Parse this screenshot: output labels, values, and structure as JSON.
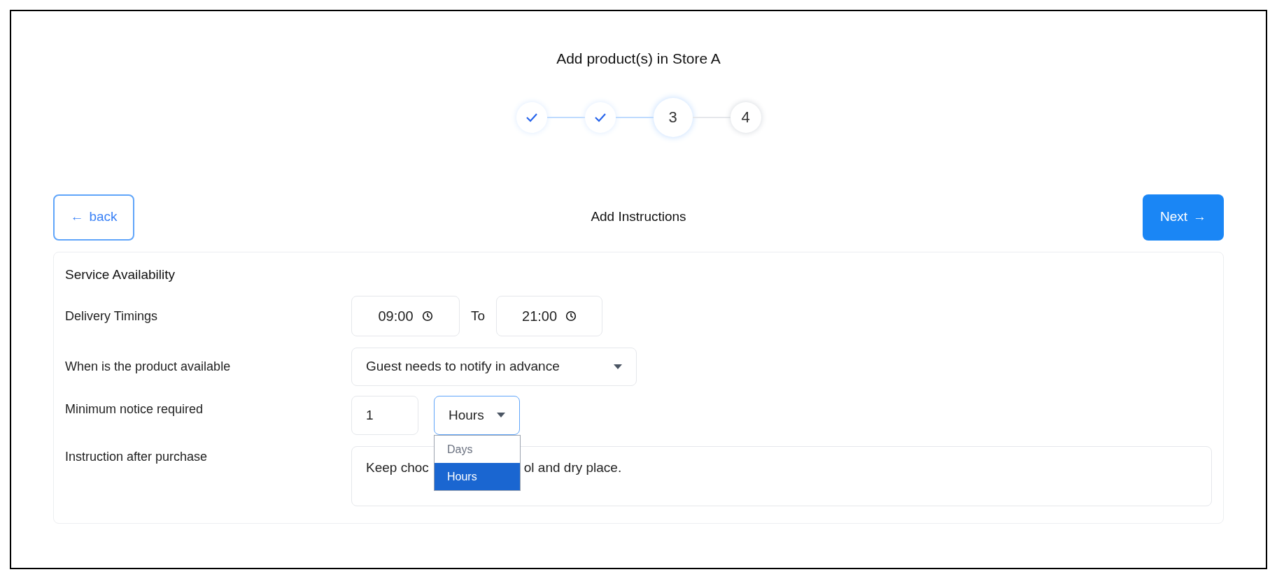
{
  "title": "Add product(s) in Store A",
  "steps": [
    {
      "done": true,
      "selected": false
    },
    {
      "done": true,
      "selected": false
    },
    {
      "done": false,
      "selected": true,
      "label": "3"
    },
    {
      "done": false,
      "selected": false,
      "label": "4"
    }
  ],
  "back_button": {
    "arrow": "←",
    "label": "back"
  },
  "section_title": "Add Instructions",
  "next_button": {
    "label": "Next",
    "arrow": "→"
  },
  "card": {
    "heading": "Service Availability",
    "delivery": {
      "label": "Delivery Timings",
      "from": "09:00",
      "separator": "To",
      "to": "21:00"
    },
    "availability": {
      "label": "When is the product available",
      "value": "Guest needs to notify in advance"
    },
    "notice": {
      "label": "Minimum notice required",
      "amount": "1",
      "unit": "Hours",
      "expanded": true,
      "options": [
        {
          "label": "Days",
          "selected": false
        },
        {
          "label": "Hours",
          "selected": true
        }
      ]
    },
    "instruction": {
      "label": "Instruction after purchase",
      "visible_start": "Keep choc",
      "visible_end": "ol and dry place."
    }
  }
}
